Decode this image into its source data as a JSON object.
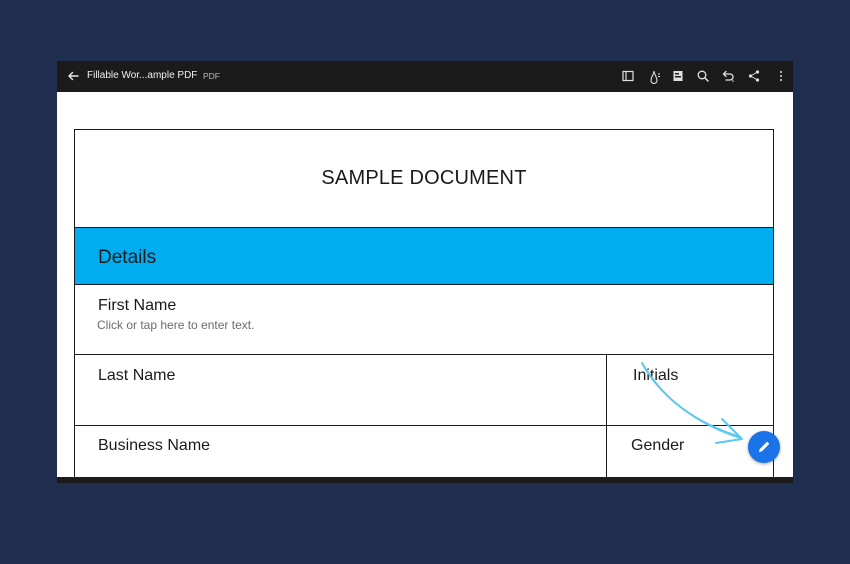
{
  "toolbar": {
    "title": "Fillable Wor...ample PDF",
    "file_type": "PDF",
    "icons": [
      "back-arrow-icon",
      "panel-icon",
      "ink-icon",
      "bookmark-icon",
      "search-icon",
      "undo-icon",
      "share-icon",
      "more-icon"
    ]
  },
  "document": {
    "title": "SAMPLE DOCUMENT",
    "section": "Details",
    "section_color": "#00adef",
    "fields": {
      "first_name": {
        "label": "First Name",
        "placeholder": "Click or tap here to enter text."
      },
      "last_name": {
        "label": "Last Name"
      },
      "initials": {
        "label": "Initials"
      },
      "business_name": {
        "label": "Business Name"
      },
      "gender": {
        "label": "Gender"
      }
    }
  },
  "fab": {
    "icon": "pencil-icon",
    "color": "#1a73e8"
  },
  "annotation": {
    "color": "#5cc8ee"
  }
}
